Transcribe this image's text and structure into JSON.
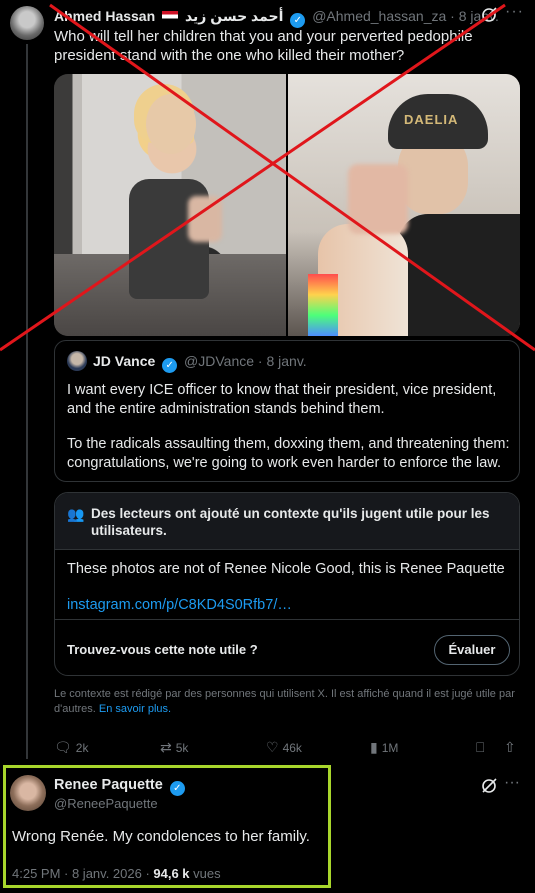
{
  "tweet": {
    "author_name": "Ahmed Hassan",
    "author_name_arabic": "أحمد حسن زيد",
    "handle": "@Ahmed_hassan_za",
    "date": "8 janv.",
    "text": "Who will tell her children that you and your perverted pedophile president stand with the one who killed their mother?",
    "media_cap_text": "DAELIA"
  },
  "quote": {
    "author_name": "JD Vance",
    "handle": "@JDVance",
    "date": "8 janv.",
    "paragraph1": "I want every ICE officer to know that their president, vice president, and the entire administration stands behind them.",
    "paragraph2": "To the radicals assaulting them, doxxing them, and threatening them: congratulations, we're going to work even harder to enforce the law."
  },
  "note": {
    "title": "Des lecteurs ont ajouté un contexte qu'ils jugent utile pour les utilisateurs.",
    "body": "These photos are not of Renee Nicole Good, this is Renee Paquette",
    "link": "instagram.com/p/C8KD4S0Rfb7/…",
    "question": "Trouvez-vous cette note utile ?",
    "rate_label": "Évaluer",
    "footer": "Le contexte est rédigé par des personnes qui utilisent X. Il est affiché quand il est jugé utile par d'autres.",
    "footer_link": "En savoir plus."
  },
  "actions": {
    "replies": "2k",
    "reposts": "5k",
    "likes": "46k",
    "views": "1M"
  },
  "reply": {
    "author_name": "Renee Paquette",
    "handle": "@ReneePaquette",
    "text": "Wrong Renée. My condolences to her family.",
    "time": "4:25 PM · 8 janv. 2026 · ",
    "views_count": "94,6 k",
    "views_label": " vues"
  },
  "colors": {
    "accent": "#1d9bf0",
    "highlight_border": "#a8d62c",
    "cross": "#e0161b",
    "background": "#000000"
  }
}
